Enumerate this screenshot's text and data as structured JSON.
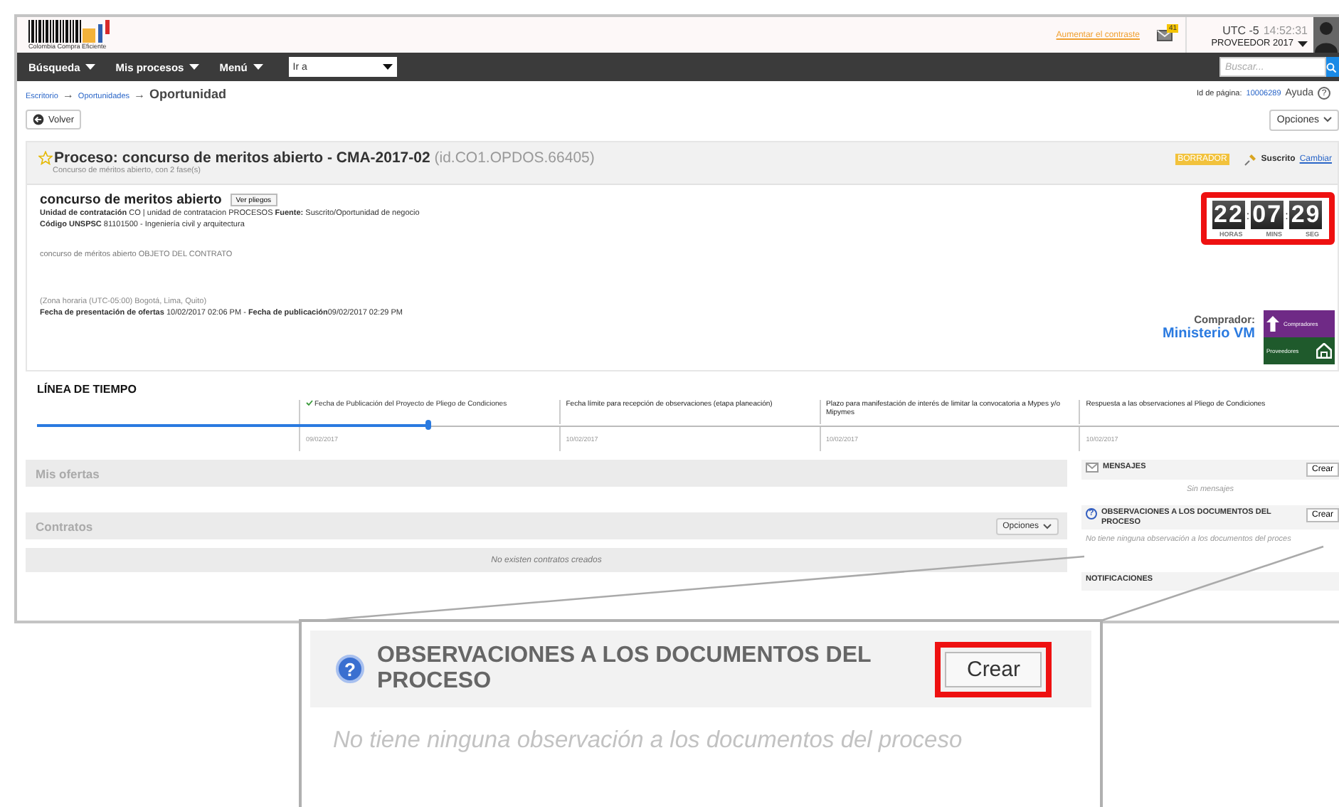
{
  "header": {
    "logo_text": "Colombia Compra Eficiente",
    "contrast_link": "Aumentar el contraste",
    "mail_badge": "41",
    "clock": {
      "zone": "UTC -5",
      "time": "14:52:31"
    },
    "user": "PROVEEDOR 2017"
  },
  "nav": {
    "menus": [
      {
        "label": "Búsqueda"
      },
      {
        "label": "Mis procesos"
      },
      {
        "label": "Menú"
      }
    ],
    "goto": {
      "value": "Ir a"
    },
    "search": {
      "placeholder": "Buscar..."
    }
  },
  "breadcrumb": {
    "separator": "→",
    "items": [
      {
        "label": "Escritorio",
        "kind": "link"
      },
      {
        "label": "Oportunidades",
        "kind": "link"
      },
      {
        "label": "Oportunidad",
        "kind": "current"
      }
    ]
  },
  "page_info": {
    "label": "Id de página:",
    "id": "10006289",
    "help": "Ayuda",
    "help_icon": "?"
  },
  "back_button": "Volver",
  "options_button": "Opciones",
  "process": {
    "title": "**Proceso: concurso de meritos abierto - CMA-2017-02** (id.CO1.OPDOS.66405)",
    "subtitle": "Concurso de méritos abierto, con 2 fase(s)",
    "status": "BORRADOR",
    "subscription": "Suscrito",
    "change_link": "Cambiar",
    "name": "concurso de meritos abierto",
    "docs_button": "Ver pliegos",
    "info_lines": [
      "**Unidad de contratación** CO | unidad de contratacion PROCESOS **Fuente:** Suscrito/Oportunidad de negocio",
      "**Código UNSPSC** 81101500 - Ingeniería civil y arquitectura"
    ],
    "description": "concurso de méritos abierto OBJETO DEL CONTRATO",
    "timezone": "(Zona horaria (UTC-05:00) Bogotá, Lima, Quito)",
    "dates": "**Fecha de presentación de ofertas** 10/02/2017 02:06 PM - **Fecha de publicación**09/02/2017 02:29 PM",
    "countdown": {
      "highlighted": true,
      "separator": ":",
      "units": [
        {
          "value": "22",
          "label": "HORAS"
        },
        {
          "value": "07",
          "label": "MINS"
        },
        {
          "value": "29",
          "label": "SEG"
        }
      ]
    },
    "buyer_label": "Comprador:",
    "buyer": "Ministerio VM",
    "logo": {
      "top": "Compradores",
      "bottom": "Proveedores"
    }
  },
  "timeline": {
    "title": "LÍNEA DE TIEMPO",
    "level": 0.3,
    "milestones": [
      {
        "title": "Fecha de Publicación del Proyecto de Pliego de Condiciones",
        "date": "09/02/2017",
        "done": true
      },
      {
        "title": "Fecha límite para recepción de observaciones (etapa planeación)",
        "date": "10/02/2017",
        "done": false
      },
      {
        "title": "Plazo para manifestación de interés de limitar la convocatoria a Mypes y/o Mipymes",
        "date": "10/02/2017",
        "done": false
      },
      {
        "title": "Respuesta a las observaciones al Pliego de Condiciones",
        "date": "10/02/2017",
        "done": false
      }
    ]
  },
  "offers": {
    "title": "Mis ofertas"
  },
  "contracts": {
    "title": "Contratos",
    "button": "Opciones",
    "empty": "No existen contratos creados"
  },
  "sidebar": [
    {
      "kind": "messages",
      "title": "MENSAJES",
      "button": "Crear",
      "empty": "Sin mensajes"
    },
    {
      "kind": "observations",
      "title": "OBSERVACIONES A LOS DOCUMENTOS DEL PROCESO",
      "button": "Crear",
      "empty": "No tiene ninguna observación a los documentos del proces",
      "icon": "?"
    },
    {
      "kind": "notifications",
      "title": "NOTIFICACIONES"
    }
  ],
  "callout": {
    "icon": "?",
    "title": "OBSERVACIONES A LOS DOCUMENTOS DEL PROCESO",
    "button": "Crear",
    "highlighted": true,
    "empty": "No tiene ninguna observación a los documentos del proceso"
  }
}
